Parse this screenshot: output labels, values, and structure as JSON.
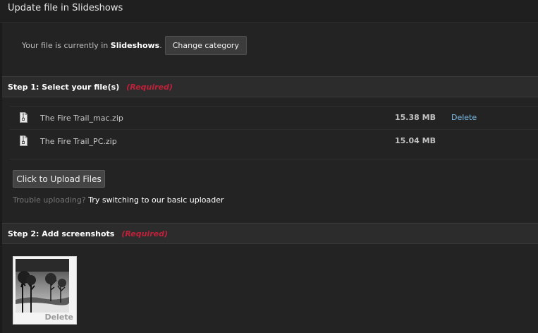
{
  "header": {
    "title": "Update file in Slideshows"
  },
  "category": {
    "prefix": "Your file is currently in ",
    "name": "Slideshows",
    "suffix": ".",
    "change_label": "Change category"
  },
  "step1": {
    "title": "Step 1: Select your file(s)",
    "required": "(Required)"
  },
  "files": [
    {
      "name": "The Fire Trail_mac.zip",
      "size": "15.38 MB",
      "delete_label": "Delete",
      "icon": "zip-file-icon"
    },
    {
      "name": "The Fire Trail_PC.zip",
      "size": "15.04 MB",
      "delete_label": "",
      "icon": "zip-file-icon"
    }
  ],
  "upload": {
    "button_label": "Click to Upload Files",
    "trouble_text": "Trouble uploading?",
    "basic_link": "Try switching to our basic uploader"
  },
  "step2": {
    "title": "Step 2: Add screenshots",
    "required": "(Required)"
  },
  "screenshots": [
    {
      "delete_label": "Delete"
    }
  ],
  "colors": {
    "background": "#1b1b1b",
    "panel": "#232323",
    "required": "#c0203a",
    "link": "#7cbde6"
  }
}
